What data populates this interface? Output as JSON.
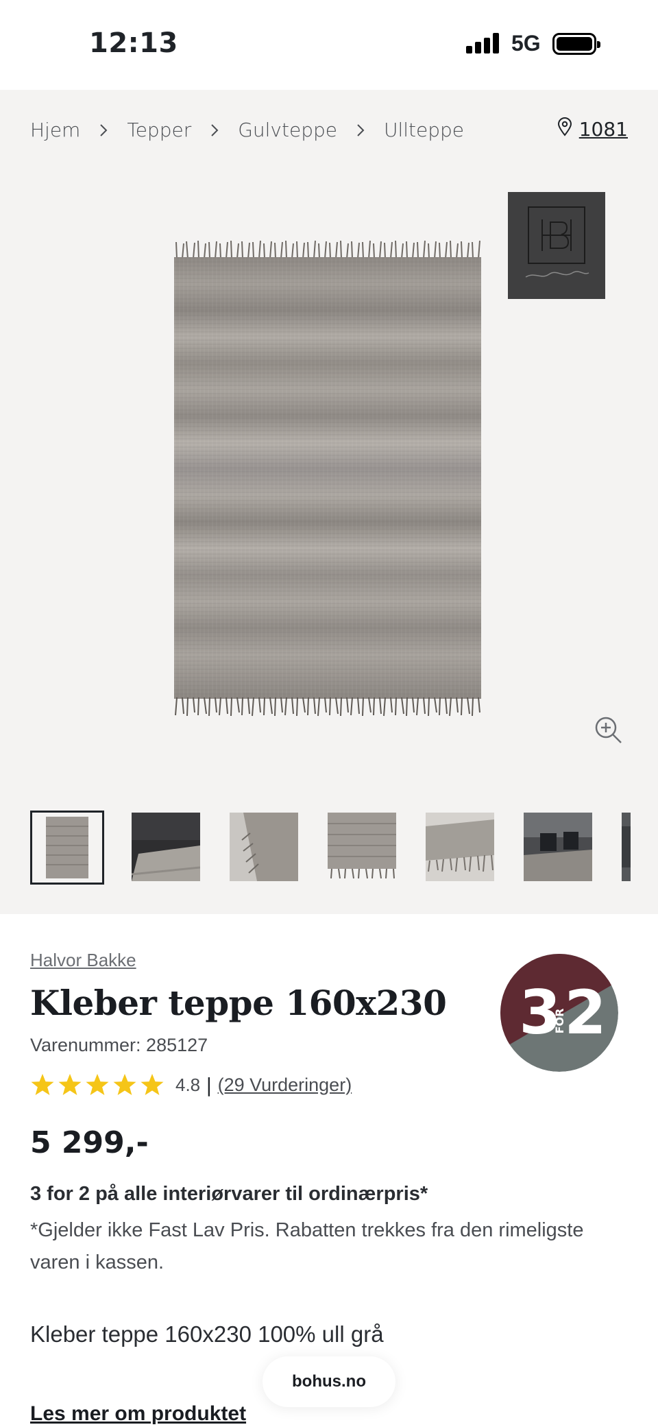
{
  "status_bar": {
    "time": "12:13",
    "network": "5G"
  },
  "breadcrumb": {
    "items": [
      "Hjem",
      "Tepper",
      "Gulvteppe",
      "Ullteppe"
    ]
  },
  "store": {
    "icon": "location-pin-icon",
    "value": "1081"
  },
  "brand_logo": {
    "initials": "HB",
    "signature": "Halvor Bakke"
  },
  "thumbnails": [
    "rug-front",
    "rug-in-living-room",
    "rug-corner-fringe",
    "rug-front-detail",
    "rug-fringe-closeup",
    "rug-with-chairs",
    "rug-partial"
  ],
  "product": {
    "brand": "Halvor Bakke",
    "title": "Kleber teppe 160x230",
    "sku": "Varenummer: 285127",
    "rating_value": "4.8",
    "rating_divider": "|",
    "rating_count": "(29 Vurderinger)",
    "rating_stars": 5,
    "price": "5 299,-",
    "promo_title": "3 for 2 på alle interiørvarer til ordinærpris*",
    "promo_text": "*Gjelder ikke Fast Lav Pris. Rabatten trekkes fra den rimeligste varen i kassen.",
    "description": "Kleber teppe 160x230 100% ull grå",
    "read_more": "Les mer om produktet"
  },
  "badge": {
    "big_left": "3",
    "small": "FOR",
    "big_right": "2"
  },
  "browser": {
    "domain": "bohus.no"
  },
  "colors": {
    "badge_top": "#5e2a32",
    "badge_bottom": "#6d7675",
    "star": "#f5c518",
    "gallery_bg": "#f4f3f2"
  }
}
